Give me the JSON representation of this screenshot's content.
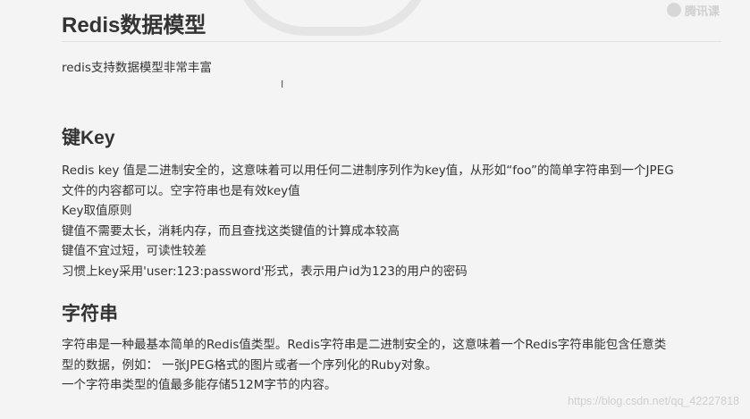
{
  "logo": {
    "text": "腾讯课"
  },
  "title": "Redis数据模型",
  "intro": "redis支持数据模型非常丰富",
  "cursor_glyph": "I",
  "sections": [
    {
      "heading": "键Key",
      "lines": [
        "Redis key 值是二进制安全的，这意味着可以用任何二进制序列作为key值，从形如“foo”的简单字符串到一个JPEG",
        "文件的内容都可以。空字符串也是有效key值",
        "Key取值原则",
        "键值不需要太长，消耗内存，而且查找这类键值的计算成本较高",
        "键值不宜过短，可读性较差",
        "习惯上key采用'user:123:password'形式，表示用户id为123的用户的密码"
      ]
    },
    {
      "heading": "字符串",
      "lines": [
        "字符串是一种最基本简单的Redis值类型。Redis字符串是二进制安全的，这意味着一个Redis字符串能包含任意类",
        "型的数据，例如： 一张JPEG格式的图片或者一个序列化的Ruby对象。",
        "一个字符串类型的值最多能存储512M字节的内容。"
      ]
    }
  ],
  "footer": "https://blog.csdn.net/qq_42227818"
}
